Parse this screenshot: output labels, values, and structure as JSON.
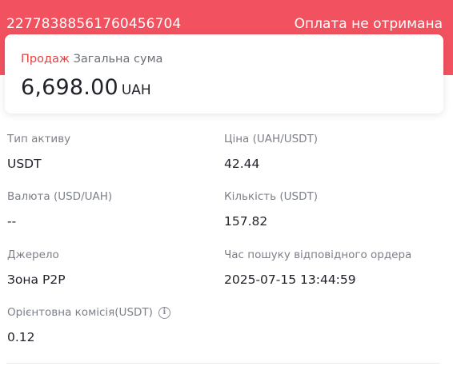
{
  "header": {
    "order_id": "22778388561760456704",
    "payment_status": "Оплата не отримана",
    "accent_color": "#f2525f"
  },
  "summary": {
    "side_label": "Продаж",
    "total_label": "Загальна сума",
    "amount": "6,698.00",
    "currency": "UAH"
  },
  "details": {
    "asset_type": {
      "label": "Тип активу",
      "value": "USDT"
    },
    "price": {
      "label": "Ціна (UAH/USDT)",
      "value": "42.44"
    },
    "fiat": {
      "label": "Валюта (USD/UAH)",
      "value": "--"
    },
    "quantity": {
      "label": "Кількість (USDT)",
      "value": "157.82"
    },
    "source": {
      "label": "Джерело",
      "value": "Зона P2P"
    },
    "match_time": {
      "label": "Час пошуку відповідного ордера",
      "value": "2025-07-15 13:44:59"
    },
    "fee": {
      "label": "Орієнтовна комісія(USDT)",
      "value": "0.12",
      "icon": "info-icon"
    }
  }
}
